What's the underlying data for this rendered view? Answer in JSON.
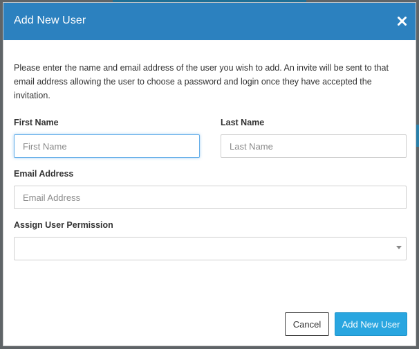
{
  "modal": {
    "title": "Add New User",
    "close_icon": "close-icon",
    "intro": "Please enter the name and email address of the user you wish to add. An invite will be sent to that email address allowing the user to choose a password and login once they have accepted the invitation."
  },
  "form": {
    "first_name": {
      "label": "First Name",
      "placeholder": "First Name",
      "value": ""
    },
    "last_name": {
      "label": "Last Name",
      "placeholder": "Last Name",
      "value": ""
    },
    "email": {
      "label": "Email Address",
      "placeholder": "Email Address",
      "value": ""
    },
    "permission": {
      "label": "Assign User Permission",
      "selected": ""
    }
  },
  "footer": {
    "cancel_label": "Cancel",
    "submit_label": "Add New User"
  },
  "colors": {
    "header": "#2c81bf",
    "primary_button": "#29a6e0",
    "focus_ring": "#66afe9"
  }
}
